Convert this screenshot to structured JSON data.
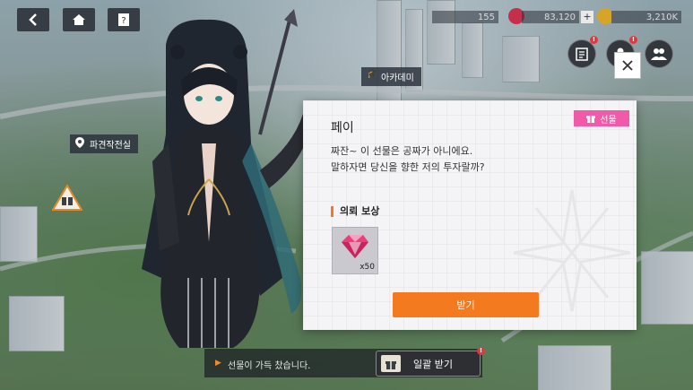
{
  "resources": {
    "stamina": "155",
    "gems": "83,120",
    "gold": "3,210K",
    "plus": "+"
  },
  "map_labels": {
    "academy": "아카데미",
    "dispatch": "파견작전실"
  },
  "dialog": {
    "title": "페이",
    "message": "짜잔~ 이 선물은 공짜가 아니에요.\n말하자면 당신을 향한 저의 투자랄까?",
    "tag": "선물",
    "reward_title": "의뢰 보상",
    "reward_count": "x50",
    "receive_label": "받기"
  },
  "bottom": {
    "notice": "선물이 가득 찼습니다.",
    "claim_all": "일괄 받기"
  },
  "badges": {
    "mark": "!"
  },
  "colors": {
    "accent_orange": "#f47a1f",
    "tag_pink": "#f15aa8",
    "alert_red": "#e0383e"
  }
}
